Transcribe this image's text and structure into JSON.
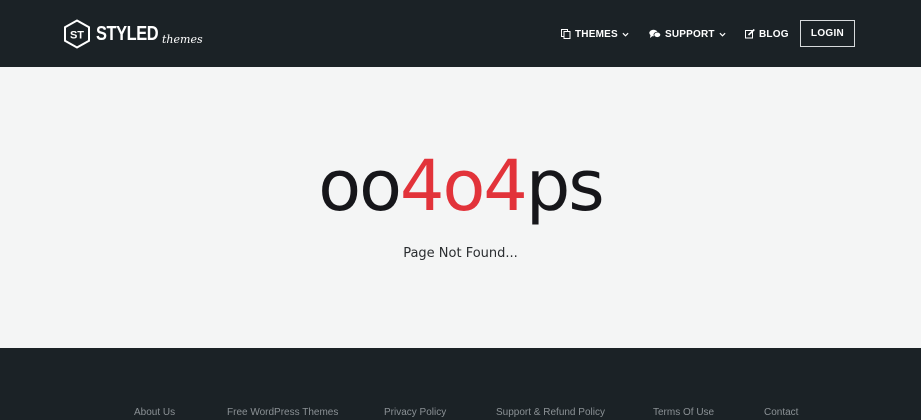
{
  "brand": {
    "badge_text": "ST",
    "name": "STYLED",
    "script": "themes"
  },
  "nav": {
    "themes": "THEMES",
    "support": "SUPPORT",
    "blog": "BLOG",
    "login": "LOGIN"
  },
  "error": {
    "title_parts": [
      "oo",
      "4o4",
      "ps"
    ],
    "subtitle": "Page Not Found..."
  },
  "footer": {
    "links": [
      "About Us",
      "Free WordPress Themes",
      "Privacy Policy",
      "Support & Refund Policy",
      "Terms Of Use",
      "Contact"
    ]
  },
  "colors": {
    "header_bg": "#1b2226",
    "page_bg": "#f4f5f5",
    "accent_red": "#e2333a"
  }
}
